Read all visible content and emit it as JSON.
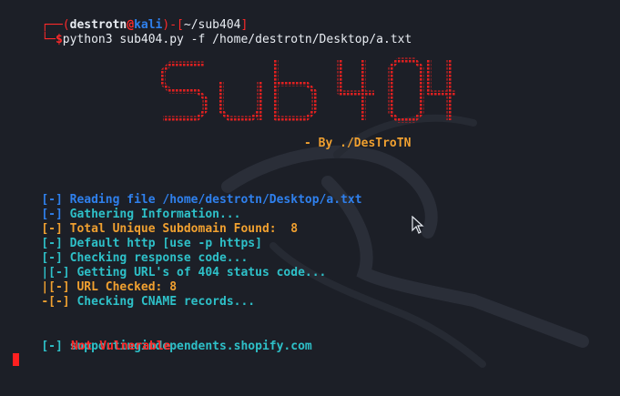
{
  "prompt": {
    "line1": {
      "corner": "┌──",
      "bracket_open": "(",
      "user": "destrotn",
      "at": "@",
      "host": "kali",
      "bracket_close": ")",
      "dash": "-",
      "dir_open": "[",
      "dir": "~/sub404",
      "dir_close": "]"
    },
    "line2": {
      "corner": "└─",
      "dollar": "$",
      "command": "python3 sub404.py -f /home/destrotn/Desktop/a.txt"
    }
  },
  "banner": {
    "logo_text": "Sub 404",
    "byline": "- By ./DesTroTN"
  },
  "output": [
    {
      "prefix": "[-]",
      "text": "Reading file /home/destrotn/Desktop/a.txt",
      "color": "#2f80ed"
    },
    {
      "prefix": "[-]",
      "text": "Gathering Information...",
      "color": "#2ec0c8"
    },
    {
      "prefix": "[-]",
      "text": "Total Unique Subdomain Found:  8",
      "color": "#f0a030"
    },
    {
      "prefix": "[-]",
      "text": "Default http [use -p https]",
      "color": "#2ec0c8"
    },
    {
      "prefix": "[-]",
      "text": "Checking response code...",
      "color": "#2ec0c8"
    },
    {
      "prefix": "|[-]",
      "text": "Getting URL's of 404 status code...",
      "color": "#2ec0c8"
    },
    {
      "prefix": "|[-]",
      "text": "URL Checked: 8",
      "color": "#f0a030"
    },
    {
      "prefix": "-[-]",
      "text": "Checking CNAME records...",
      "color": "#2ec0c8"
    }
  ],
  "result": {
    "prefix": "[-]",
    "domain": "supportingindependents.shopify.com",
    "status": "Not Vulnerable"
  },
  "colors": {
    "background": "#1c1f27",
    "blue": "#2f80ed",
    "cyan": "#2ec0c8",
    "orange": "#f0a030",
    "red": "#ff2a2a"
  },
  "icons": {
    "cursor": "text-cursor-block",
    "pointer": "mouse-pointer-icon"
  }
}
